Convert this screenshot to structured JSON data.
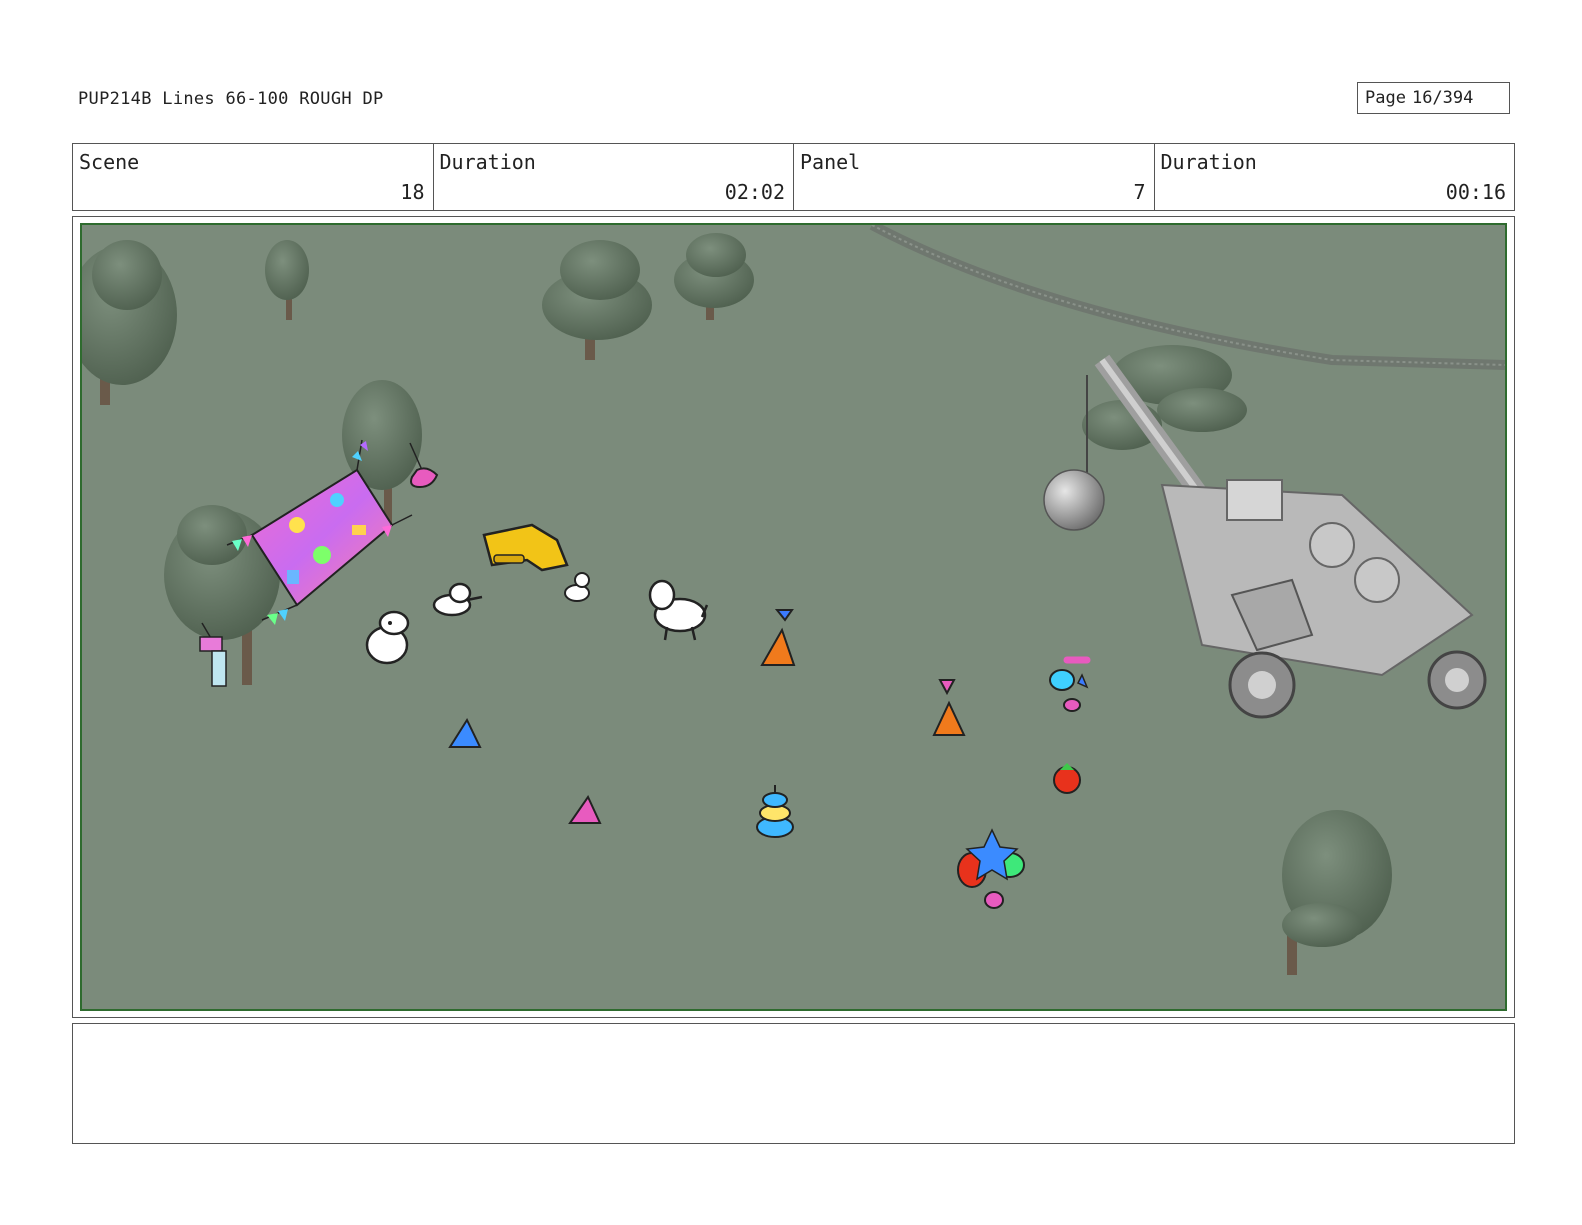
{
  "header": {
    "title": "PUP214B Lines 66-100 ROUGH DP",
    "page_label": "Page",
    "page_value": "16/394"
  },
  "info": {
    "scene_label": "Scene",
    "scene_value": "18",
    "scene_duration_label": "Duration",
    "scene_duration_value": "02:02",
    "panel_label": "Panel",
    "panel_value": "7",
    "panel_duration_label": "Duration",
    "panel_duration_value": "00:16"
  },
  "panel": {
    "colors": {
      "ground": "#7b8b7b",
      "tree": "#5f6f5f",
      "frame": "#2e6b2e",
      "digger": "#f2c417",
      "crane": "#b9b9b9",
      "banner": "#e85bbf"
    }
  },
  "notes": {
    "text": ""
  }
}
